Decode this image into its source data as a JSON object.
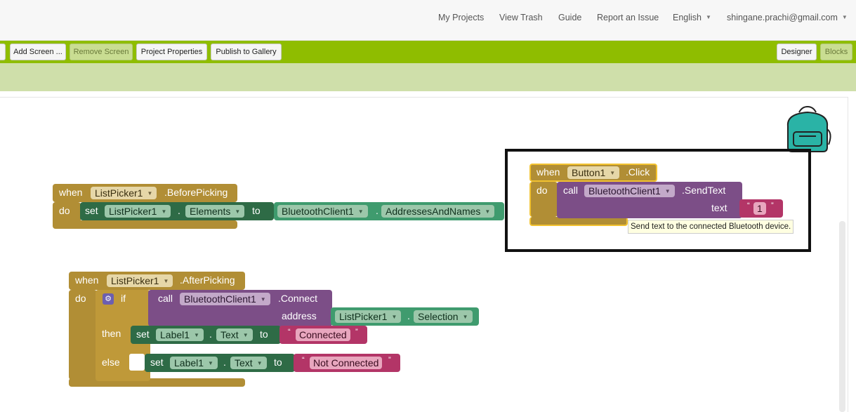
{
  "nav": {
    "my_projects": "My Projects",
    "view_trash": "View Trash",
    "guide": "Guide",
    "report_issue": "Report an Issue",
    "language": "English",
    "account": "shingane.prachi@gmail.com"
  },
  "toolbar": {
    "add_screen": "Add Screen ...",
    "remove_screen": "Remove Screen",
    "project_properties": "Project Properties",
    "publish_gallery": "Publish to Gallery",
    "designer": "Designer",
    "blocks": "Blocks"
  },
  "blocks": {
    "before": {
      "when": "when",
      "component": "ListPicker1",
      "event": ".BeforePicking",
      "do": "do",
      "set": "set",
      "set_component": "ListPicker1",
      "dot": ".",
      "property": "Elements",
      "to": "to",
      "value_component": "BluetoothClient1",
      "value_property": "AddressesAndNames"
    },
    "click": {
      "when": "when",
      "component": "Button1",
      "event": ".Click",
      "do": "do",
      "call": "call",
      "call_component": "BluetoothClient1",
      "method": ".SendText",
      "arg": "text",
      "quote_open": "“",
      "quote_close": "”",
      "text_value": "1",
      "tooltip": "Send text to the connected Bluetooth device."
    },
    "after": {
      "when": "when",
      "component": "ListPicker1",
      "event": ".AfterPicking",
      "do": "do",
      "if": "if",
      "call": "call",
      "call_component": "BluetoothClient1",
      "method": ".Connect",
      "arg": "address",
      "addr_component": "ListPicker1",
      "addr_property": "Selection",
      "then": "then",
      "else": "else",
      "set": "set",
      "to": "to",
      "dot": ".",
      "label": "Label1",
      "property": "Text",
      "quote_open": "“",
      "quote_close": "”",
      "then_value": "Connected",
      "else_value": "Not Connected"
    }
  },
  "colors": {
    "green_bar": "#8fbd00",
    "event": "#b18e35",
    "setter": "#2e6b46",
    "procedure": "#7c4e87",
    "text": "#b33567"
  }
}
